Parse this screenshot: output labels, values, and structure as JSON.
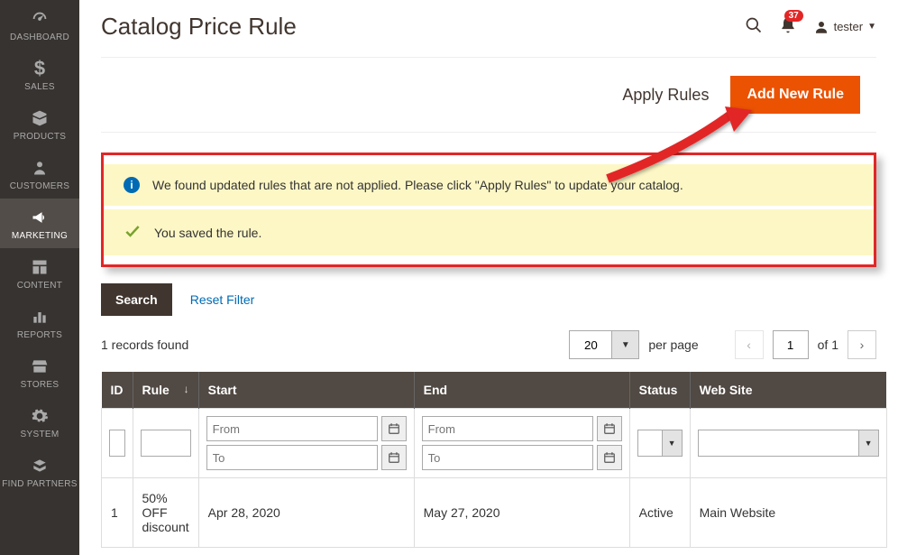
{
  "sidebar": {
    "items": [
      {
        "label": "DASHBOARD"
      },
      {
        "label": "SALES"
      },
      {
        "label": "PRODUCTS"
      },
      {
        "label": "CUSTOMERS"
      },
      {
        "label": "MARKETING"
      },
      {
        "label": "CONTENT"
      },
      {
        "label": "REPORTS"
      },
      {
        "label": "STORES"
      },
      {
        "label": "SYSTEM"
      },
      {
        "label": "FIND PARTNERS"
      }
    ]
  },
  "header": {
    "title": "Catalog Price Rule",
    "notif_count": "37",
    "user_name": "tester"
  },
  "actionbar": {
    "apply_label": "Apply Rules",
    "add_label": "Add New Rule"
  },
  "messages": {
    "info": "We found updated rules that are not applied. Please click \"Apply Rules\" to update your catalog.",
    "success": "You saved the rule."
  },
  "filterbar": {
    "search_label": "Search",
    "reset_label": "Reset Filter"
  },
  "paging": {
    "records_text": "1 records found",
    "per_page_value": "20",
    "per_page_label": "per page",
    "current_page": "1",
    "of_label": "of 1"
  },
  "columns": {
    "id": "ID",
    "rule": "Rule",
    "start": "Start",
    "end": "End",
    "status": "Status",
    "website": "Web Site"
  },
  "filters": {
    "from_placeholder": "From",
    "to_placeholder": "To"
  },
  "rows": [
    {
      "id": "1",
      "rule": "50% OFF discount",
      "start": "Apr 28, 2020",
      "end": "May 27, 2020",
      "status": "Active",
      "website": "Main Website"
    }
  ]
}
